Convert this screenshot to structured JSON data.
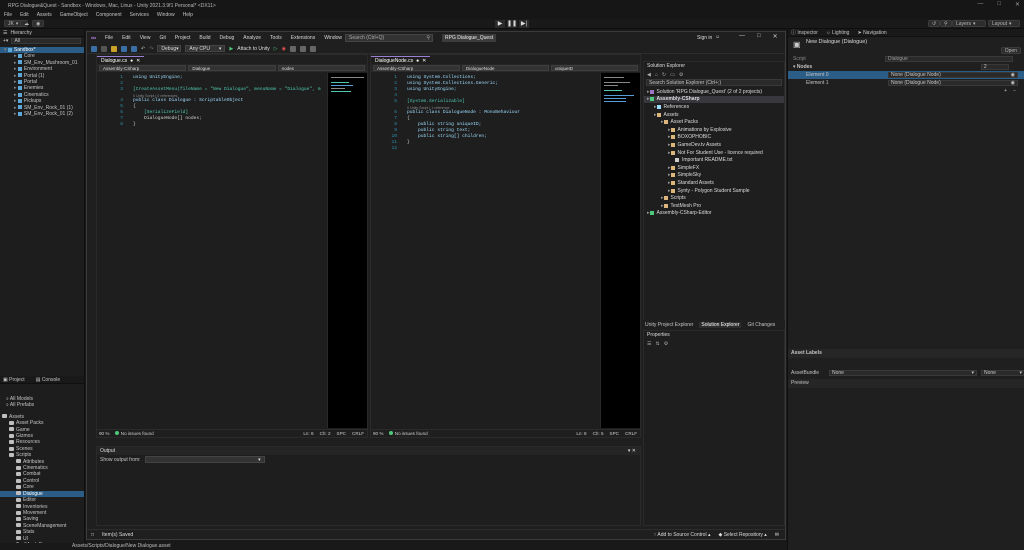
{
  "unity": {
    "title": "RPG Dialogue&Quest - Sandbox - Windows, Mac, Linux - Unity 2021.3.9f1 Personal* <DX11>",
    "menu": [
      "File",
      "Edit",
      "Assets",
      "GameObject",
      "Component",
      "Services",
      "Window",
      "Help"
    ],
    "account": "JK",
    "layers": "Layers",
    "layout": "Layout"
  },
  "hierarchy": {
    "tab": "Hierarchy",
    "search_label": "All",
    "items": [
      {
        "label": "Sandbox*",
        "depth": 0,
        "sel": true
      },
      {
        "label": "Core",
        "depth": 1
      },
      {
        "label": "SM_Env_Mushroom_01",
        "depth": 1
      },
      {
        "label": "Environment",
        "depth": 1
      },
      {
        "label": "Portal (1)",
        "depth": 1
      },
      {
        "label": "Portal",
        "depth": 1
      },
      {
        "label": "Enemies",
        "depth": 1
      },
      {
        "label": "Cinematics",
        "depth": 1
      },
      {
        "label": "Pickups",
        "depth": 1
      },
      {
        "label": "SM_Env_Rock_01 (1)",
        "depth": 1
      },
      {
        "label": "SM_Env_Rock_01 (2)",
        "depth": 1
      }
    ]
  },
  "project": {
    "tabs": [
      "Project",
      "Console"
    ],
    "favorites": [
      "All Models",
      "All Prefabs"
    ],
    "tree": [
      {
        "label": "Assets",
        "depth": 0
      },
      {
        "label": "Asset Packs",
        "depth": 1
      },
      {
        "label": "Game",
        "depth": 1
      },
      {
        "label": "Gizmos",
        "depth": 1
      },
      {
        "label": "Resources",
        "depth": 1
      },
      {
        "label": "Scenes",
        "depth": 1
      },
      {
        "label": "Scripts",
        "depth": 1
      },
      {
        "label": "Attributes",
        "depth": 2
      },
      {
        "label": "Cinematics",
        "depth": 2
      },
      {
        "label": "Combat",
        "depth": 2
      },
      {
        "label": "Control",
        "depth": 2
      },
      {
        "label": "Core",
        "depth": 2
      },
      {
        "label": "Dialogue",
        "depth": 2,
        "sel": true
      },
      {
        "label": "Editor",
        "depth": 2
      },
      {
        "label": "Inventories",
        "depth": 2
      },
      {
        "label": "Movement",
        "depth": 2
      },
      {
        "label": "Saving",
        "depth": 2
      },
      {
        "label": "SceneManagement",
        "depth": 2
      },
      {
        "label": "Stats",
        "depth": 2
      },
      {
        "label": "UI",
        "depth": 2
      },
      {
        "label": "TextMesh Pro",
        "depth": 1
      }
    ],
    "path": "Assets/Scripts/Dialogue/New Dialogue.asset"
  },
  "vs": {
    "menu": [
      "File",
      "Edit",
      "View",
      "Git",
      "Project",
      "Build",
      "Debug",
      "Analyze",
      "Tools",
      "Extensions",
      "Window",
      "Help"
    ],
    "search_placeholder": "Search (Ctrl+Q)",
    "solution_badge": "RPG Dialogue_Quest",
    "sign_in": "Sign in",
    "config": "Debug",
    "platform": "Any CPU",
    "attach": "Attach to Unity",
    "left_editor": {
      "tab": "Dialogue.cs",
      "nav": [
        "Assembly-CSharp",
        "Dialogue",
        "nodes"
      ],
      "zoom": "90 %",
      "issues": "No issues found",
      "ln": "Ln: 8",
      "ch": "Ch: 2",
      "spc": "SPC",
      "crlf": "CRLF"
    },
    "right_editor": {
      "tab": "DialogueNode.cs",
      "nav": [
        "Assembly-CSharp",
        "DialogueNode",
        "uniqueID"
      ],
      "zoom": "90 %",
      "issues": "No issues found",
      "ln": "Ln: 8",
      "ch": "Ch: 5",
      "spc": "SPC",
      "crlf": "CRLF"
    },
    "left_code": [
      {
        "n": "1",
        "t": "using UnityEngine;"
      },
      {
        "n": "2",
        "t": ""
      },
      {
        "n": "3",
        "t": "[CreateAssetMenu(fileName = \"New Dialogue\", menuName = \"Dialogue\", m"
      },
      {
        "n": "",
        "t": "0 Unity Script | 0 references",
        "lens": true
      },
      {
        "n": "4",
        "t": "public class Dialogue : ScriptableObject"
      },
      {
        "n": "5",
        "t": "{"
      },
      {
        "n": "6",
        "t": "    [SerializeField]"
      },
      {
        "n": "7",
        "t": "    DialogueNode[] nodes;"
      },
      {
        "n": "8",
        "t": "}"
      }
    ],
    "right_code": [
      {
        "n": "1",
        "t": "using System.Collections;"
      },
      {
        "n": "2",
        "t": "using System.Collections.Generic;"
      },
      {
        "n": "3",
        "t": "using UnityEngine;"
      },
      {
        "n": "4",
        "t": ""
      },
      {
        "n": "5",
        "t": "[System.Serializable]"
      },
      {
        "n": "",
        "t": "0 Unity Script | 1 reference",
        "lens": true
      },
      {
        "n": "6",
        "t": "public class DialogueNode : MonoBehaviour"
      },
      {
        "n": "7",
        "t": "{"
      },
      {
        "n": "8",
        "t": "    public string uniqueID;"
      },
      {
        "n": "9",
        "t": "    public string text;"
      },
      {
        "n": "10",
        "t": "    public string[] children;"
      },
      {
        "n": "11",
        "t": "}"
      },
      {
        "n": "12",
        "t": ""
      }
    ],
    "output": {
      "title": "Output",
      "show_from": "Show output from:"
    },
    "status": {
      "saved": "Item(s) Saved",
      "source_control": "Add to Source Control",
      "repo": "Select Repository"
    },
    "solution_explorer": {
      "title": "Solution Explorer",
      "search": "Search Solution Explorer (Ctrl+;)",
      "items": [
        {
          "label": "Solution 'RPG Dialogue_Quest' (2 of 2 projects)",
          "depth": 0,
          "kind": "sln"
        },
        {
          "label": "Assembly-CSharp",
          "depth": 0,
          "kind": "proj",
          "bold": true
        },
        {
          "label": "References",
          "depth": 1,
          "kind": "ref"
        },
        {
          "label": "Assets",
          "depth": 1,
          "kind": "folder"
        },
        {
          "label": "Asset Packs",
          "depth": 2,
          "kind": "folder"
        },
        {
          "label": "Animations by Explosive",
          "depth": 3,
          "kind": "folder"
        },
        {
          "label": "BOXOPHOBIC",
          "depth": 3,
          "kind": "folder"
        },
        {
          "label": "GameDev.tv Assets",
          "depth": 3,
          "kind": "folder"
        },
        {
          "label": "Not For Student Use - licence required",
          "depth": 3,
          "kind": "folder"
        },
        {
          "label": "Important README.txt",
          "depth": 4,
          "kind": "file"
        },
        {
          "label": "SimpleFX",
          "depth": 3,
          "kind": "folder"
        },
        {
          "label": "SimpleSky",
          "depth": 3,
          "kind": "folder"
        },
        {
          "label": "Standard Assets",
          "depth": 3,
          "kind": "folder"
        },
        {
          "label": "Synty - Polygon Student Sample",
          "depth": 3,
          "kind": "folder"
        },
        {
          "label": "Scripts",
          "depth": 2,
          "kind": "folder"
        },
        {
          "label": "TextMesh Pro",
          "depth": 2,
          "kind": "folder"
        },
        {
          "label": "Assembly-CSharp-Editor",
          "depth": 0,
          "kind": "proj"
        }
      ],
      "bottom_tabs": [
        "Unity Project Explorer",
        "Solution Explorer",
        "Git Changes"
      ]
    },
    "properties": {
      "title": "Properties"
    }
  },
  "inspector": {
    "tabs": [
      "Inspector",
      "Lighting",
      "Navigation"
    ],
    "asset_name": "New Dialogue (Dialogue)",
    "open": "Open",
    "script_label": "Script",
    "script_value": "Dialogue",
    "nodes_label": "Nodes",
    "nodes_count": "2",
    "elements": [
      {
        "label": "Element 0",
        "value": "None (Dialogue Node)"
      },
      {
        "label": "Element 1",
        "value": "None (Dialogue Node)"
      }
    ],
    "asset_labels": "Asset Labels",
    "asset_bundle": "AssetBundle",
    "bundle_value": "None",
    "variant_value": "None",
    "preview": "Preview"
  }
}
